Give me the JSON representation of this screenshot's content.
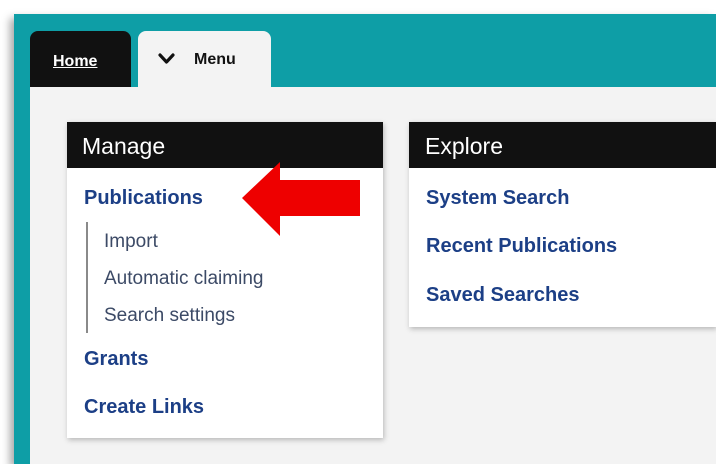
{
  "tabs": {
    "home_label": "Home",
    "menu_label": "Menu"
  },
  "manage": {
    "title": "Manage",
    "publications_label": "Publications",
    "sub_items": [
      "Import",
      "Automatic claiming",
      "Search settings"
    ],
    "grants_label": "Grants",
    "create_links_label": "Create Links"
  },
  "explore": {
    "title": "Explore",
    "items": [
      "System Search",
      "Recent Publications",
      "Saved Searches"
    ]
  },
  "colors": {
    "frame": "#0e9ea6",
    "link": "#1c3f86",
    "header": "#111111",
    "arrow": "#ee0000"
  },
  "icons": {
    "menu_toggle": "chevron-down-icon",
    "annotation": "red-arrow-left-icon"
  }
}
